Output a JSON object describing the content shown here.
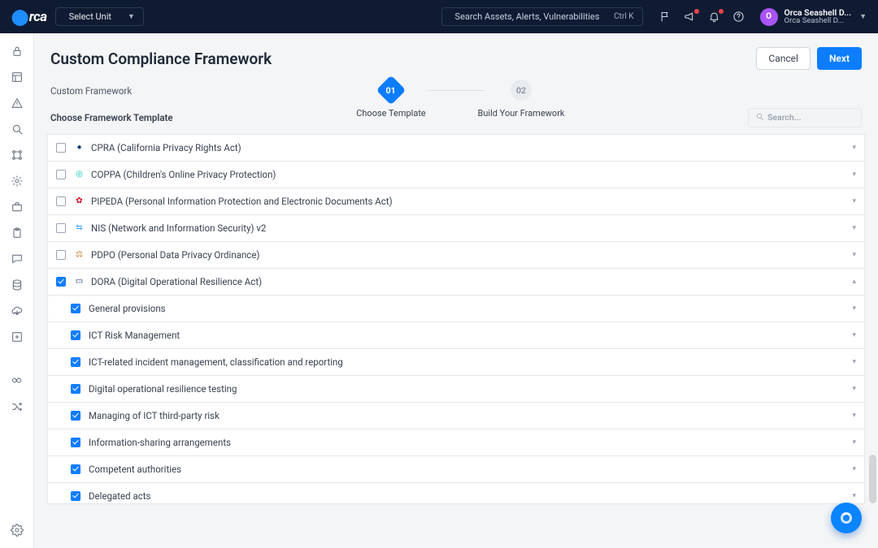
{
  "top": {
    "select_unit": "Select Unit",
    "search_placeholder": "Search Assets, Alerts, Vulnerabilities",
    "search_kbd": "Ctrl K",
    "user_line1": "Orca Seashell D...",
    "user_line2": "Orca Seashell D...",
    "avatar_letter": "O"
  },
  "page": {
    "title": "Custom Compliance Framework",
    "cancel": "Cancel",
    "next": "Next",
    "step1_num": "01",
    "step1_label": "Choose Template",
    "step2_num": "02",
    "step2_label": "Build Your Framework",
    "subheader": "Custom Framework",
    "section_label": "Choose Framework Template",
    "search_placeholder": "Search..."
  },
  "frameworks": [
    {
      "checked": false,
      "icon_color": "#0b3a73",
      "icon_glyph": "●",
      "label": "CPRA (California Privacy Rights Act)",
      "chev": "▾"
    },
    {
      "checked": false,
      "icon_color": "#00c2b2",
      "icon_glyph": "◎",
      "label": "COPPA (Children's Online Privacy Protection)",
      "chev": "▾"
    },
    {
      "checked": false,
      "icon_color": "#d6061c",
      "icon_glyph": "✿",
      "label": "PIPEDA (Personal Information Protection and Electronic Documents Act)",
      "chev": "▾"
    },
    {
      "checked": false,
      "icon_color": "#3aa0ff",
      "icon_glyph": "⇆",
      "label": "NIS (Network and Information Security) v2",
      "chev": "▾"
    },
    {
      "checked": false,
      "icon_color": "#b97d2b",
      "icon_glyph": "⚖",
      "label": "PDPO (Personal Data Privacy Ordinance)",
      "chev": "▾"
    },
    {
      "checked": true,
      "icon_color": "#0a2a6b",
      "icon_glyph": "▭",
      "label": "DORA (Digital Operational Resilience Act)",
      "chev": "▴"
    }
  ],
  "dora_children": [
    {
      "label": "General provisions"
    },
    {
      "label": "ICT Risk Management"
    },
    {
      "label": "ICT-related incident management, classification and reporting"
    },
    {
      "label": "Digital operational resilience testing"
    },
    {
      "label": "Managing of ICT third-party risk"
    },
    {
      "label": "Information-sharing arrangements"
    },
    {
      "label": "Competent authorities"
    },
    {
      "label": "Delegated acts"
    }
  ]
}
